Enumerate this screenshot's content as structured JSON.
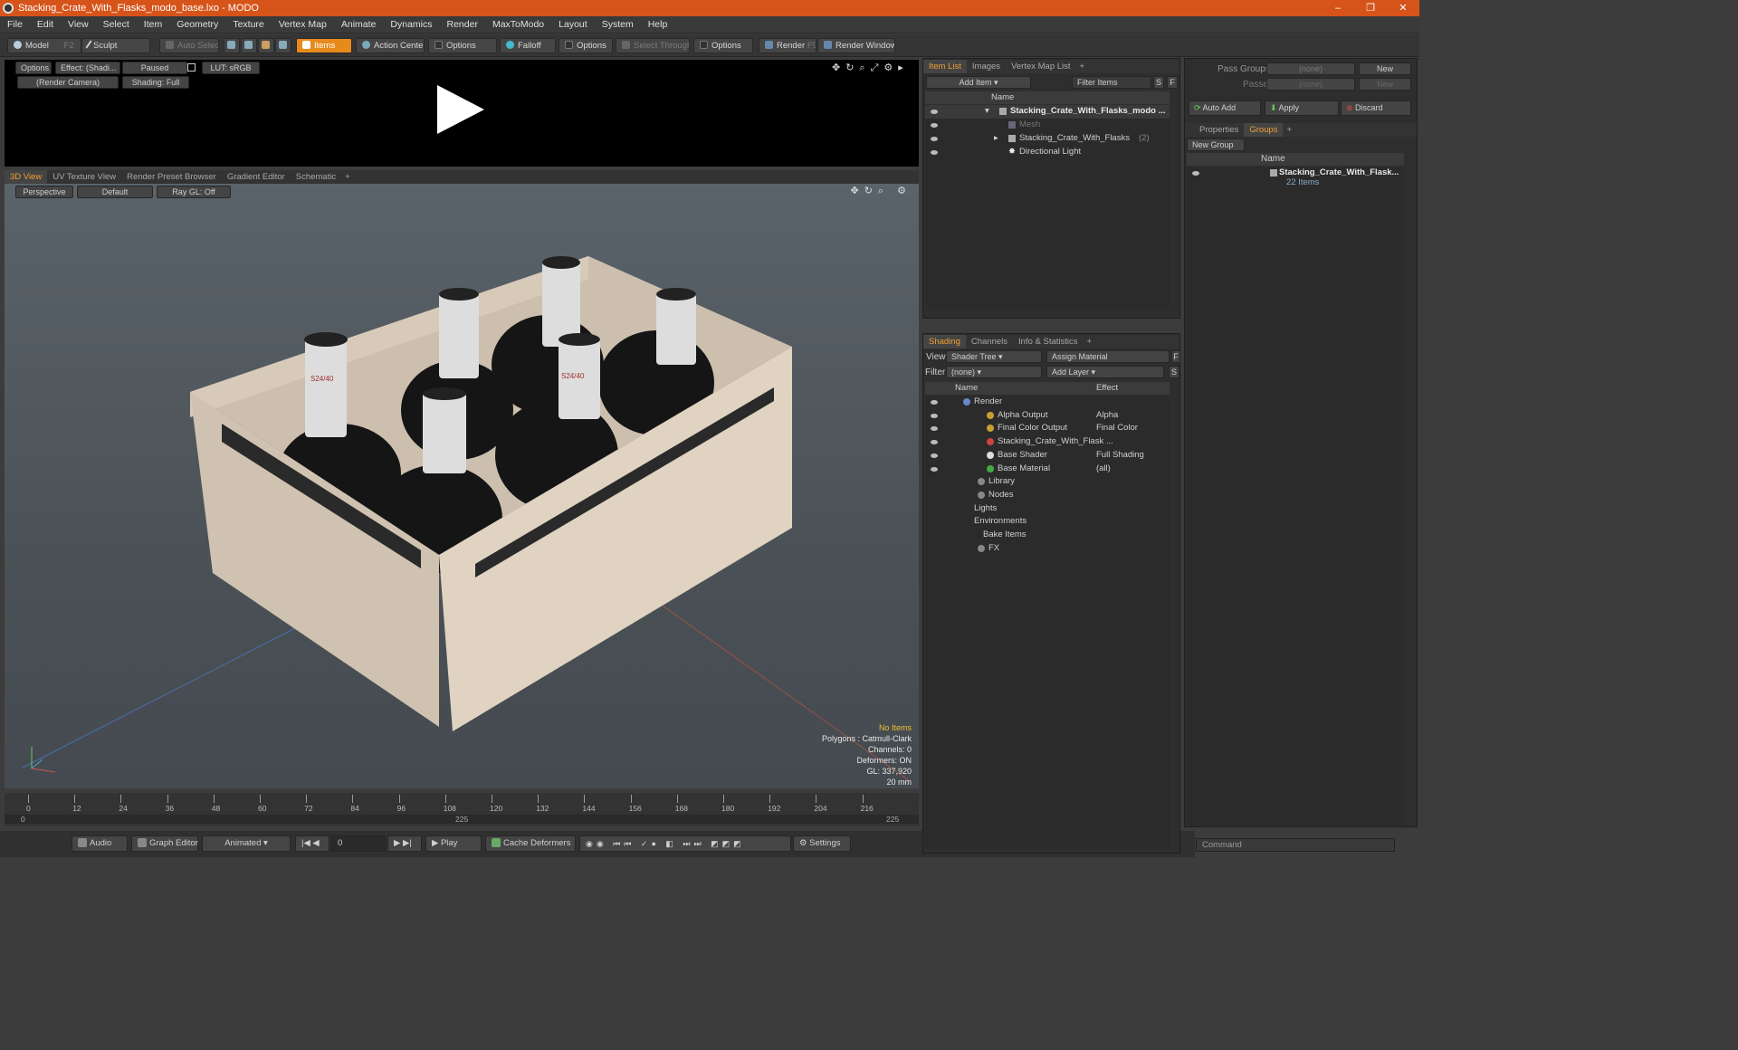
{
  "window": {
    "title": "Stacking_Crate_With_Flasks_modo_base.lxo - MODO",
    "min": "–",
    "max": "❐",
    "close": "✕"
  },
  "menu": [
    "File",
    "Edit",
    "View",
    "Select",
    "Item",
    "Geometry",
    "Texture",
    "Vertex Map",
    "Animate",
    "Dynamics",
    "Render",
    "MaxToModo",
    "Layout",
    "System",
    "Help"
  ],
  "toolbar": {
    "model": "Model",
    "model_key": "F2",
    "sculpt": "Sculpt",
    "auto_select": "Auto Select",
    "items": "Items",
    "action_center": "Action Center",
    "options1": "Options",
    "falloff": "Falloff",
    "options2": "Options",
    "select_through": "Select Through",
    "options3": "Options",
    "render": "Render",
    "render_key": "F9",
    "render_window": "Render Window"
  },
  "preview": {
    "options": "Options",
    "effect": "Effect: (Shadi...",
    "paused": "Paused",
    "lut": "LUT: sRGB",
    "camera": "(Render Camera)",
    "shading": "Shading: Full"
  },
  "viewport_tabs": [
    "3D View",
    "UV Texture View",
    "Render Preset Browser",
    "Gradient Editor",
    "Schematic"
  ],
  "viewport": {
    "perspective": "Perspective",
    "default": "Default",
    "raygl": "Ray GL: Off",
    "hud": [
      "No Items",
      "Polygons : Catmull-Clark",
      "Channels: 0",
      "Deformers: ON",
      "GL: 337,920",
      "20 mm"
    ],
    "flask_label": "S24/40"
  },
  "timeline": {
    "ticks": [
      "0",
      "12",
      "24",
      "36",
      "48",
      "60",
      "72",
      "84",
      "96",
      "108",
      "120",
      "132",
      "144",
      "156",
      "168",
      "180",
      "192",
      "204",
      "216"
    ],
    "sub_left": "0",
    "sub_mid": "225",
    "sub_right": "225"
  },
  "bottom": {
    "audio": "Audio",
    "graph_editor": "Graph Editor",
    "animated": "Animated",
    "frame": "0",
    "play": "Play",
    "cache_deformers": "Cache Deformers",
    "settings": "Settings"
  },
  "item_list": {
    "tabs": [
      "Item List",
      "Images",
      "Vertex Map List"
    ],
    "add_item": "Add Item",
    "filter_items": "Filter Items",
    "s": "S",
    "f": "F",
    "col_name": "Name",
    "rows": [
      {
        "label": "Stacking_Crate_With_Flasks_modo ..."
      },
      {
        "label": "Mesh"
      },
      {
        "label": "Stacking_Crate_With_Flasks",
        "count": "(2)"
      },
      {
        "label": "Directional Light"
      }
    ]
  },
  "shading": {
    "tabs": [
      "Shading",
      "Channels",
      "Info & Statistics"
    ],
    "view_label": "View",
    "view_value": "Shader Tree",
    "assign_material": "Assign Material",
    "f": "F",
    "filter_label": "Filter",
    "filter_value": "(none)",
    "add_layer": "Add Layer",
    "s": "S",
    "col_name": "Name",
    "col_effect": "Effect",
    "rows": [
      {
        "label": "Render",
        "effect": ""
      },
      {
        "label": "Alpha Output",
        "effect": "Alpha"
      },
      {
        "label": "Final Color Output",
        "effect": "Final Color"
      },
      {
        "label": "Stacking_Crate_With_Flask ...",
        "effect": ""
      },
      {
        "label": "Base Shader",
        "effect": "Full Shading"
      },
      {
        "label": "Base Material",
        "effect": "(all)"
      },
      {
        "label": "Library",
        "effect": ""
      },
      {
        "label": "Nodes",
        "effect": ""
      },
      {
        "label": "Lights",
        "effect": ""
      },
      {
        "label": "Environments",
        "effect": ""
      },
      {
        "label": "Bake Items",
        "effect": ""
      },
      {
        "label": "FX",
        "effect": ""
      }
    ]
  },
  "right": {
    "pass_groups": "Pass Groups",
    "passes": "Passes",
    "none": "(none)",
    "new": "New",
    "auto_add": "Auto Add",
    "apply": "Apply",
    "discard": "Discard",
    "tabs": [
      "Properties",
      "Groups"
    ],
    "new_group": "New Group",
    "col_name": "Name",
    "group_name": "Stacking_Crate_With_Flask...",
    "group_count": "22 Items",
    "command": "Command"
  },
  "colors": {
    "accent": "#e68a1c",
    "title": "#d6541a",
    "tab_active": "#f0a030"
  }
}
